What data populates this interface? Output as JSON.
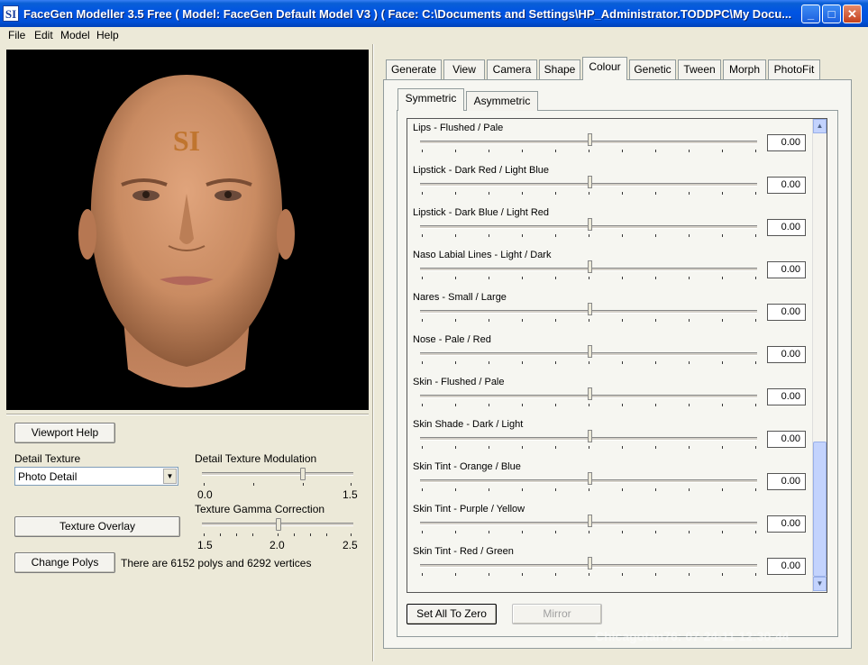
{
  "window": {
    "title": "FaceGen Modeller 3.5 Free  ( Model: FaceGen Default Model V3 )  ( Face: C:\\Documents and Settings\\HP_Administrator.TODDPC\\My Docu...",
    "icon_text": "SI",
    "min_label": "_",
    "max_label": "□",
    "close_label": "✕"
  },
  "menu": {
    "items": [
      "File",
      "Edit",
      "Model",
      "Help"
    ]
  },
  "viewport": {
    "forehead_text": "SI"
  },
  "left": {
    "viewport_help": "Viewport Help",
    "detail_texture_label": "Detail Texture",
    "detail_texture_value": "Photo Detail",
    "detail_mod_label": "Detail Texture Modulation",
    "detail_mod_min": "0.0",
    "detail_mod_max": "1.5",
    "gamma_label": "Texture Gamma Correction",
    "gamma_min": "1.5",
    "gamma_mid": "2.0",
    "gamma_max": "2.5",
    "texture_overlay": "Texture Overlay",
    "change_polys": "Change Polys",
    "poly_info": "There are 6152 polys and 6292 vertices"
  },
  "tabs": [
    "Generate",
    "View",
    "Camera",
    "Shape",
    "Colour",
    "Genetic",
    "Tween",
    "Morph",
    "PhotoFit"
  ],
  "active_tab": "Colour",
  "subtabs": [
    "Symmetric",
    "Asymmetric"
  ],
  "rows": [
    {
      "label": "Lips - Flushed / Pale",
      "value": "0.00"
    },
    {
      "label": "Lipstick - Dark Red / Light Blue",
      "value": "0.00"
    },
    {
      "label": "Lipstick - Dark Blue / Light Red",
      "value": "0.00"
    },
    {
      "label": "Naso Labial Lines - Light / Dark",
      "value": "0.00"
    },
    {
      "label": "Nares - Small / Large",
      "value": "0.00"
    },
    {
      "label": "Nose - Pale / Red",
      "value": "0.00"
    },
    {
      "label": "Skin - Flushed / Pale",
      "value": "0.00"
    },
    {
      "label": "Skin Shade - Dark / Light",
      "value": "0.00"
    },
    {
      "label": "Skin Tint - Orange / Blue",
      "value": "0.00"
    },
    {
      "label": "Skin Tint - Purple / Yellow",
      "value": "0.00"
    },
    {
      "label": "Skin Tint - Red / Green",
      "value": "0.00"
    }
  ],
  "buttons": {
    "set_all_zero": "Set All To Zero",
    "mirror": "Mirror"
  },
  "watermark": "Chicagotan76: 07-24-11 12:30:44",
  "colors": {
    "titlebar": "#0054e3",
    "face": "#c98b62",
    "forehead_text": "#c0752f"
  }
}
